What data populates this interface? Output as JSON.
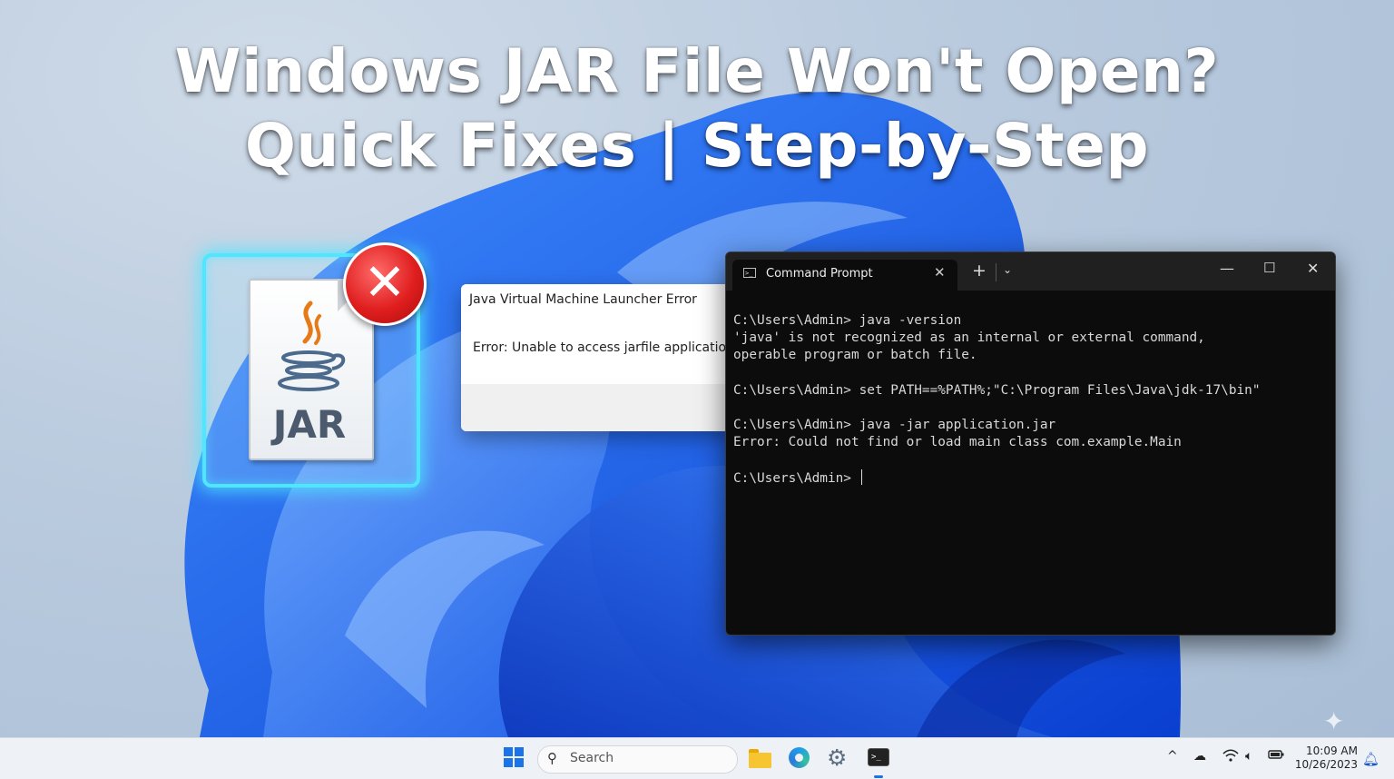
{
  "headline": {
    "line1": "Windows JAR File Won't Open?",
    "line2": "Quick Fixes | Step-by-Step"
  },
  "jar_icon": {
    "label": "JAR",
    "badge_icon": "error-x-icon"
  },
  "dialog": {
    "title": "Java Virtual Machine Launcher Error",
    "message": "Error: Unable to access jarfile application.jar"
  },
  "terminal": {
    "tab_label": "Command Prompt",
    "tab_close": "✕",
    "new_tab": "+",
    "dropdown": "⌄",
    "minimize": "—",
    "maximize": "☐",
    "close": "✕",
    "lines": [
      "C:\\Users\\Admin> java -version",
      "'java' is not recognized as an internal or external command,",
      "operable program or batch file.",
      "",
      "C:\\Users\\Admin> set PATH==%PATH%;\"C:\\Program Files\\Java\\jdk-17\\bin\"",
      "",
      "C:\\Users\\Admin> java -jar application.jar",
      "Error: Could not find or load main class com.example.Main",
      "",
      "C:\\Users\\Admin> "
    ]
  },
  "taskbar": {
    "search_placeholder": "Search",
    "apps": [
      "start-icon",
      "search-icon",
      "file-explorer-icon",
      "edge-icon",
      "settings-gear-icon",
      "terminal-icon"
    ],
    "tray": {
      "chevron": "^",
      "icons": [
        "onedrive-cloud-icon",
        "wifi-icon",
        "volume-icon",
        "battery-icon",
        "notification-bell-icon"
      ]
    },
    "time": "10:09 AM",
    "date": "10/26/2023"
  },
  "colors": {
    "accent": "#1a73e8",
    "glow": "#4fe6ff",
    "error_red": "#e01e1e",
    "terminal_bg": "#0c0c0c"
  }
}
